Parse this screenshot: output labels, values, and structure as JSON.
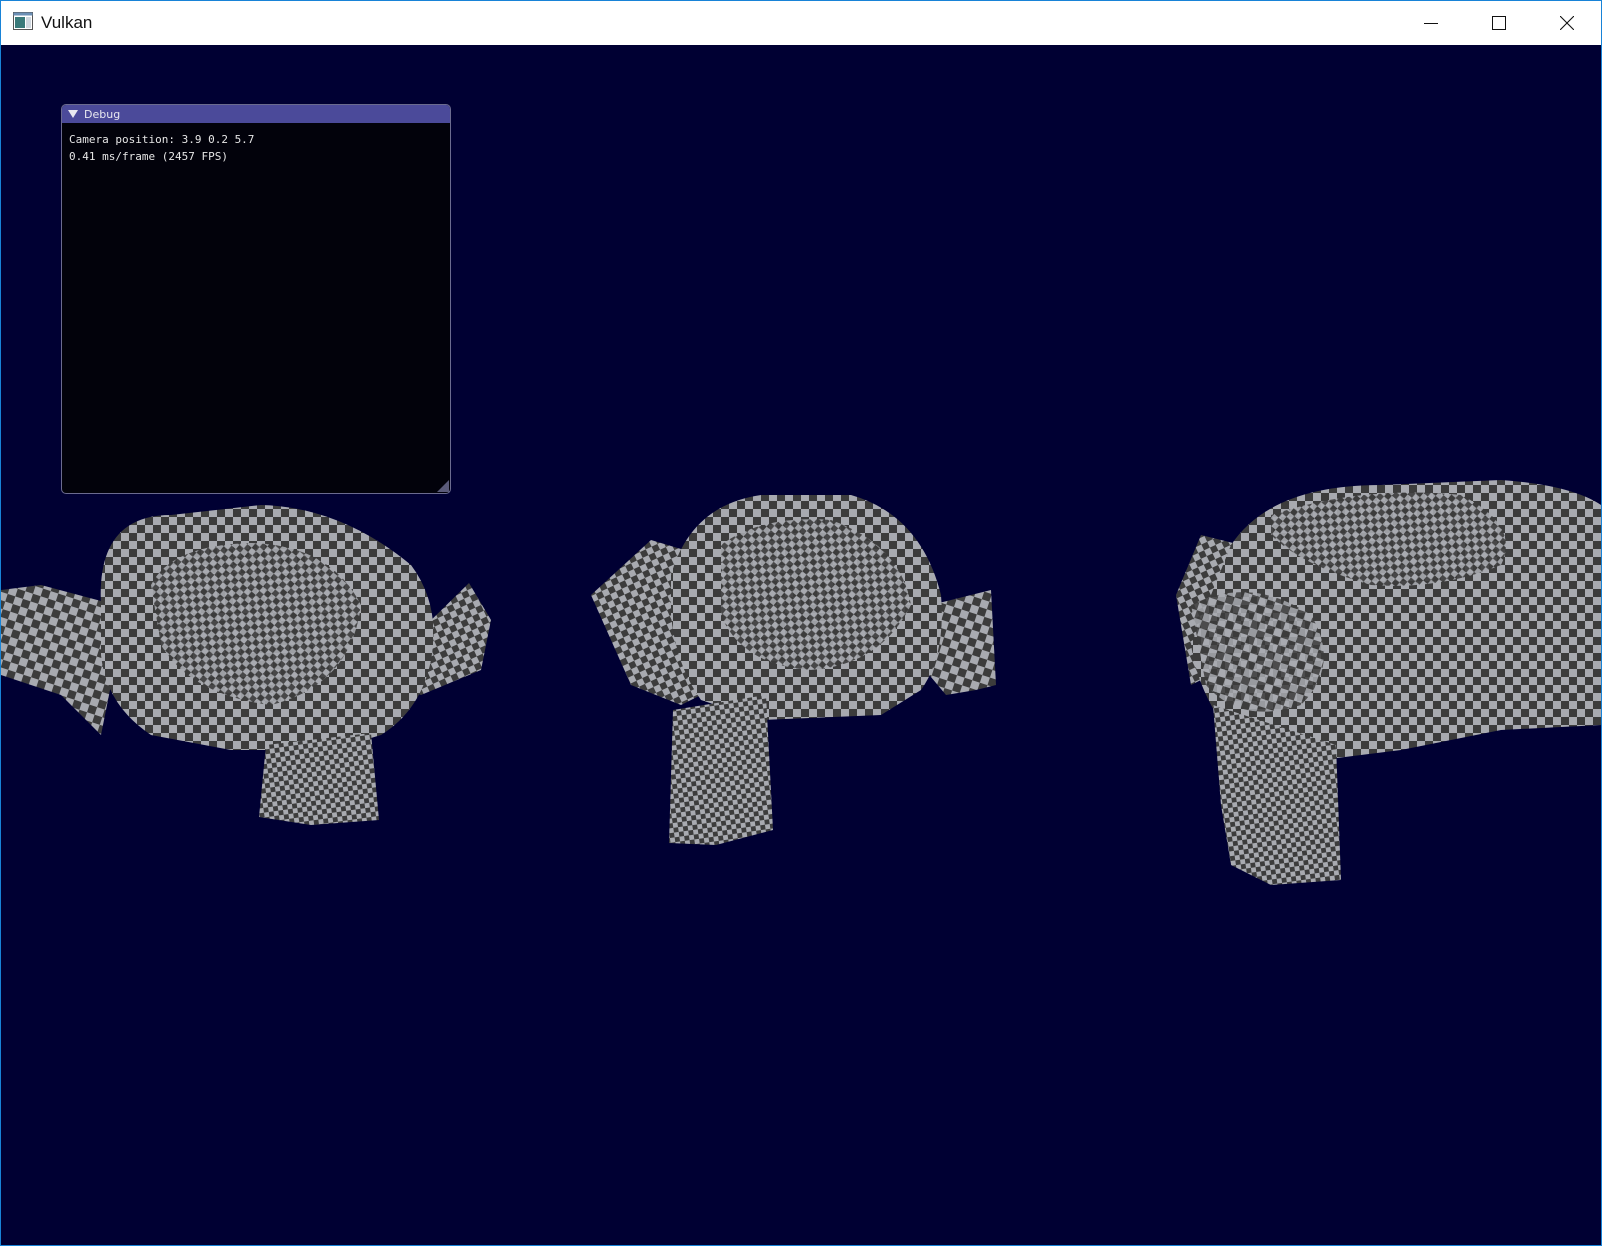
{
  "window": {
    "title": "Vulkan",
    "accent_color": "#1883d7",
    "app_icon": "vulkan-app-icon",
    "controls": {
      "minimize_icon": "minimize-icon",
      "maximize_icon": "maximize-icon",
      "close_icon": "close-icon"
    }
  },
  "viewport": {
    "background_color": "#000033",
    "objects": [
      {
        "name": "monkey-head-left",
        "texture": "checkerboard"
      },
      {
        "name": "monkey-head-center",
        "texture": "checkerboard"
      },
      {
        "name": "monkey-head-right",
        "texture": "checkerboard"
      }
    ]
  },
  "debug_panel": {
    "title": "Debug",
    "header_color": "#4b4a9a",
    "lines": {
      "camera": "Camera position: 3.9 0.2 5.7",
      "timing": "0.41 ms/frame (2457 FPS)"
    }
  }
}
